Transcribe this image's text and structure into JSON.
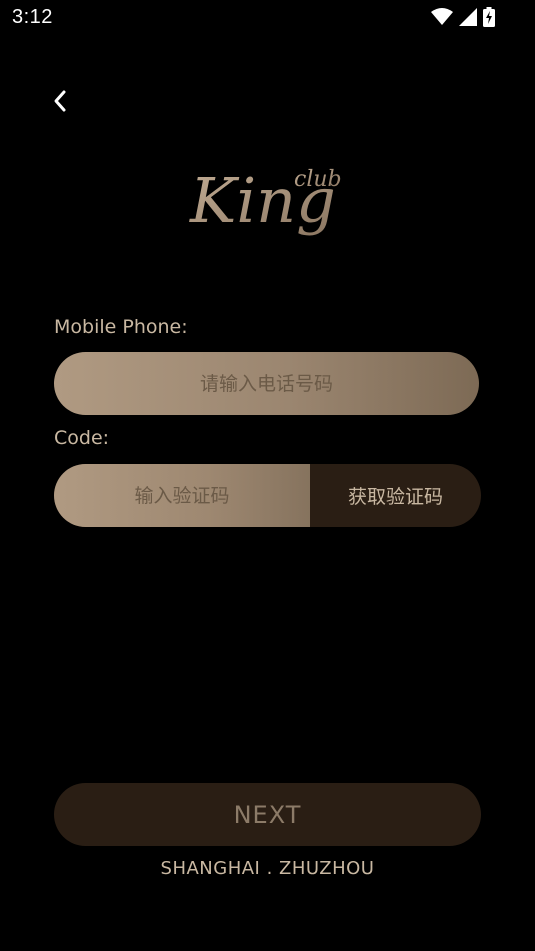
{
  "status_bar": {
    "time": "3:12",
    "icons": [
      "wifi-icon",
      "cellular-signal-icon",
      "battery-charging-icon"
    ]
  },
  "header": {
    "back_icon": "chevron-left-icon"
  },
  "logo": {
    "main": "King",
    "sub": "club"
  },
  "form": {
    "phone_label": "Mobile Phone:",
    "phone_placeholder": "请输入电话号码",
    "phone_value": "",
    "code_label": "Code:",
    "code_placeholder": "输入验证码",
    "code_value": "",
    "get_code_label": "获取验证码"
  },
  "actions": {
    "next_label": "NEXT"
  },
  "footer": {
    "location": "SHANGHAI . ZHUZHOU"
  },
  "colors": {
    "background": "#000000",
    "gold_light": "#b09a82",
    "gold_dark": "#7d6a55",
    "button_dark": "#2a1e14",
    "label_text": "#c9b8a2",
    "disabled_text": "#8c7b68"
  }
}
